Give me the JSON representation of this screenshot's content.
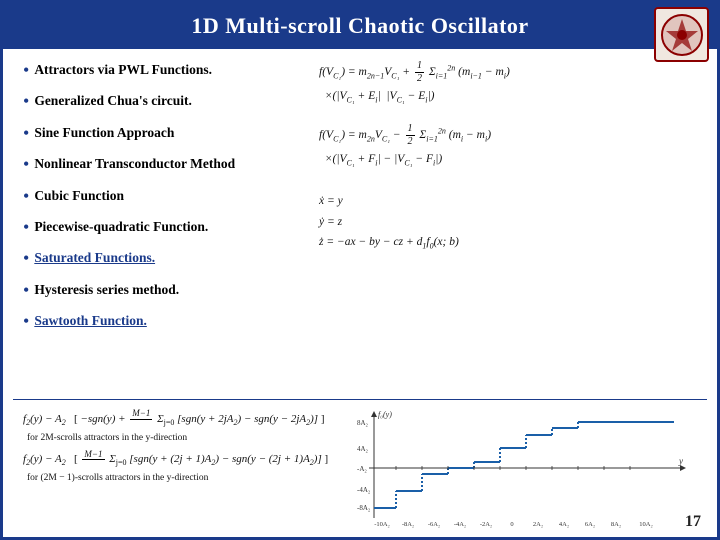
{
  "header": {
    "title": "1D Multi-scroll Chaotic Oscillator"
  },
  "bullets": [
    {
      "id": "b1",
      "text": "Attractors via PWL Functions.",
      "style": "bold"
    },
    {
      "id": "b2",
      "text": "Generalized Chua's circuit.",
      "style": "bold"
    },
    {
      "id": "b3",
      "text": "Sine Function Approach",
      "style": "bold"
    },
    {
      "id": "b4",
      "text": "Nonlinear Transconductor Method",
      "style": "bold"
    },
    {
      "id": "b5",
      "text": "Cubic Function",
      "style": "bold"
    },
    {
      "id": "b6",
      "text": "Piecewise-quadratic Function.",
      "style": "bold"
    },
    {
      "id": "b7",
      "text": "Saturated Functions.",
      "style": "bold-underline-blue"
    },
    {
      "id": "b8",
      "text": "Hysteresis series method.",
      "style": "bold"
    },
    {
      "id": "b9",
      "text": "Sawtooth Function.",
      "style": "bold-underline-blue"
    }
  ],
  "formulas": {
    "formula1_line1": "f(V₁) = m₂ₙ₋₁V₁ + ½ Σ",
    "formula1_line2": "×(|V₁ + Eᵢ| − |V₁ − Eᵢ|)",
    "formula2_line1": "f(V₁) = m₂ₙV₁ − ½ Σ",
    "formula2_line2": "×(|V₁ + Fᵢ| − |V₁ − Fᵢ|)",
    "formula3_line1": "ẋ = y",
    "formula3_line2": "ẏ = z",
    "formula3_line3": "ż = −ax − by − cz + d₁f₀(x; b)"
  },
  "bottom": {
    "formula_f2_1": "f₂(y) − A₂",
    "formula_f2_sum": "−sgn(y) + Σ [sgn(y + 2jA₂) − sgn(y − 2jA₂)]",
    "label_2M": "for 2M-scrolls attractors in the y-direction",
    "formula_f2_2_start": "f₂(y) − A₂",
    "label_2M1": "for (2M − 1)-scrolls attractors in the y-direction"
  },
  "page_number": "17",
  "chart": {
    "x_labels": [
      "-10A₂",
      "-8A₂",
      "-6A₂",
      "-4A₂",
      "-2A₂",
      "0",
      "2A₂",
      "4A₂",
      "6A₂",
      "8A₂",
      "10A₂"
    ],
    "y_labels": [
      "-8A₂",
      "-4A₂",
      "4A₂",
      "8A₂"
    ],
    "axis_label_x": "y",
    "axis_label_y": "f₀(y)"
  }
}
